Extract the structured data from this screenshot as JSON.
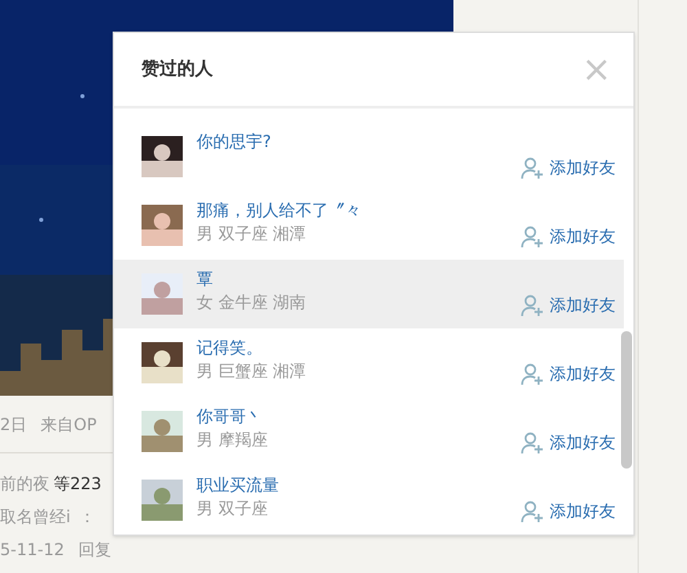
{
  "background": {
    "post_meta": [
      "2日",
      "来自OP"
    ],
    "likes_line": [
      {
        "text": "前的夜",
        "kind": "plain"
      },
      {
        "text": "等223",
        "kind": "strong"
      }
    ],
    "comment": [
      "取名曾经i",
      "："
    ],
    "comment_meta": [
      "5-11-12",
      "回复"
    ]
  },
  "dialog": {
    "title": "赞过的人",
    "close": "×",
    "users": [
      {
        "name": "你的思宇?",
        "action": "添加好友",
        "selected": false
      },
      {
        "name": "那痛，别人给不了〞々",
        "meta": "男 双子座 湘潭",
        "action": "添加好友",
        "selected": false
      },
      {
        "name": "覃",
        "meta": "女 金牛座 湖南",
        "action": "添加好友",
        "selected": true
      },
      {
        "name": "记得笑。",
        "meta": "男 巨蟹座 湘潭",
        "action": "添加好友",
        "selected": false
      },
      {
        "name": "你哥哥丶",
        "meta": "男 摩羯座",
        "action": "添加好友",
        "selected": false
      },
      {
        "name": "职业买流量",
        "meta": "男 双子座",
        "action": "添加好友",
        "selected": false
      }
    ]
  }
}
